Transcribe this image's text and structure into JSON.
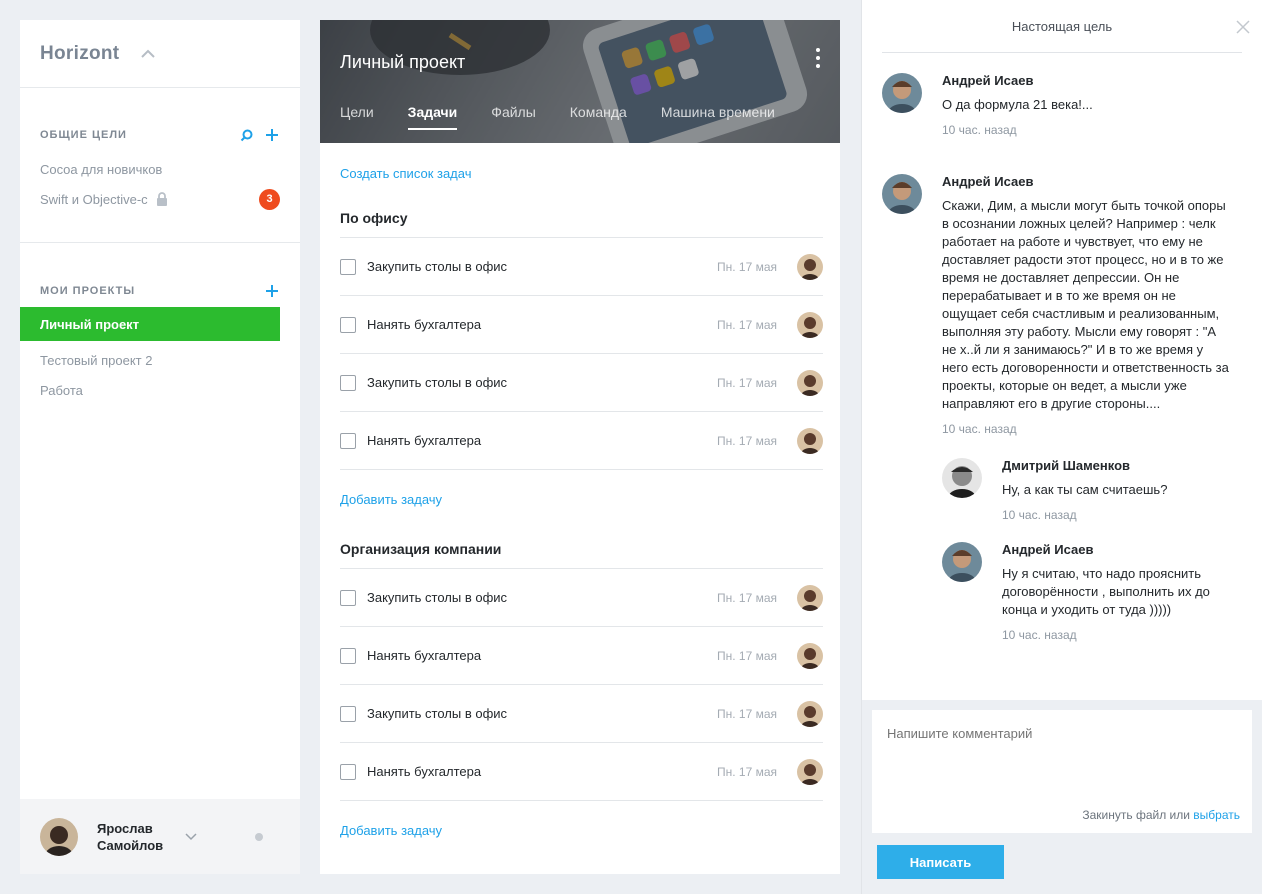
{
  "app": {
    "brand": "Horizont"
  },
  "sidebar": {
    "goals_title": "ОБЩИЕ ЦЕЛИ",
    "goals": [
      {
        "label": "Cocoa для новичков"
      },
      {
        "label": "Swift и Objective-c",
        "locked": true,
        "badge": "3"
      }
    ],
    "projects_title": "МОИ ПРОЕКТЫ",
    "projects": [
      {
        "label": "Личный проект",
        "active": true
      },
      {
        "label": "Тестовый проект 2"
      },
      {
        "label": "Работа"
      }
    ],
    "user": {
      "name": "Ярослав Самойлов"
    }
  },
  "project": {
    "title": "Личный проект",
    "tabs": [
      "Цели",
      "Задачи",
      "Файлы",
      "Команда",
      "Машина времени"
    ],
    "active_tab": "Задачи",
    "create_list_label": "Создать список задач",
    "add_task_label": "Добавить задачу",
    "groups": [
      {
        "title": "По офису",
        "tasks": [
          {
            "text": "Закупить столы в офис",
            "date": "Пн. 17 мая"
          },
          {
            "text": "Нанять бухгалтера",
            "date": "Пн. 17 мая"
          },
          {
            "text": "Закупить столы в офис",
            "date": "Пн. 17 мая"
          },
          {
            "text": "Нанять бухгалтера",
            "date": "Пн. 17 мая"
          }
        ]
      },
      {
        "title": "Организация компании",
        "tasks": [
          {
            "text": "Закупить столы в офис",
            "date": "Пн. 17 мая"
          },
          {
            "text": "Нанять бухгалтера",
            "date": "Пн. 17 мая"
          },
          {
            "text": "Закупить столы в офис",
            "date": "Пн. 17 мая"
          },
          {
            "text": "Нанять бухгалтера",
            "date": "Пн. 17 мая"
          }
        ]
      }
    ]
  },
  "panel": {
    "title": "Настоящая цель",
    "comments": [
      {
        "author": "Андрей Исаев",
        "text": "О да формула 21 века!...",
        "time": "10 час. назад"
      },
      {
        "author": "Андрей Исаев",
        "text": "Скажи, Дим, а мысли могут быть точкой опоры в осознании ложных целей? Например : челк работает на работе и чувствует, что ему не доставляет радости этот процесс, но и в то же время не доставляет депрессии. Он не перерабатывает и в то же время он не ощущает себя счастливым и реализованным, выполняя эту работу. Мысли ему говорят : \"А не х..й ли я занимаюсь?\" И в то же время у него есть договоренности и ответственность за проекты, которые он ведет, а мысли уже направляют его в другие стороны....",
        "time": "10 час. назад"
      }
    ],
    "replies": [
      {
        "author": "Дмитрий Шаменков",
        "text": "Ну, а как ты сам считаешь?",
        "time": "10 час. назад"
      },
      {
        "author": "Андрей Исаев",
        "text": "Ну я считаю, что надо прояснить договорённости , выполнить их до конца и уходить от туда )))))",
        "time": "10 час. назад"
      }
    ],
    "composer": {
      "placeholder": "Напишите комментарий",
      "attach_text": "Закинуть файл или",
      "attach_link": "выбрать",
      "send_label": "Написать"
    }
  }
}
